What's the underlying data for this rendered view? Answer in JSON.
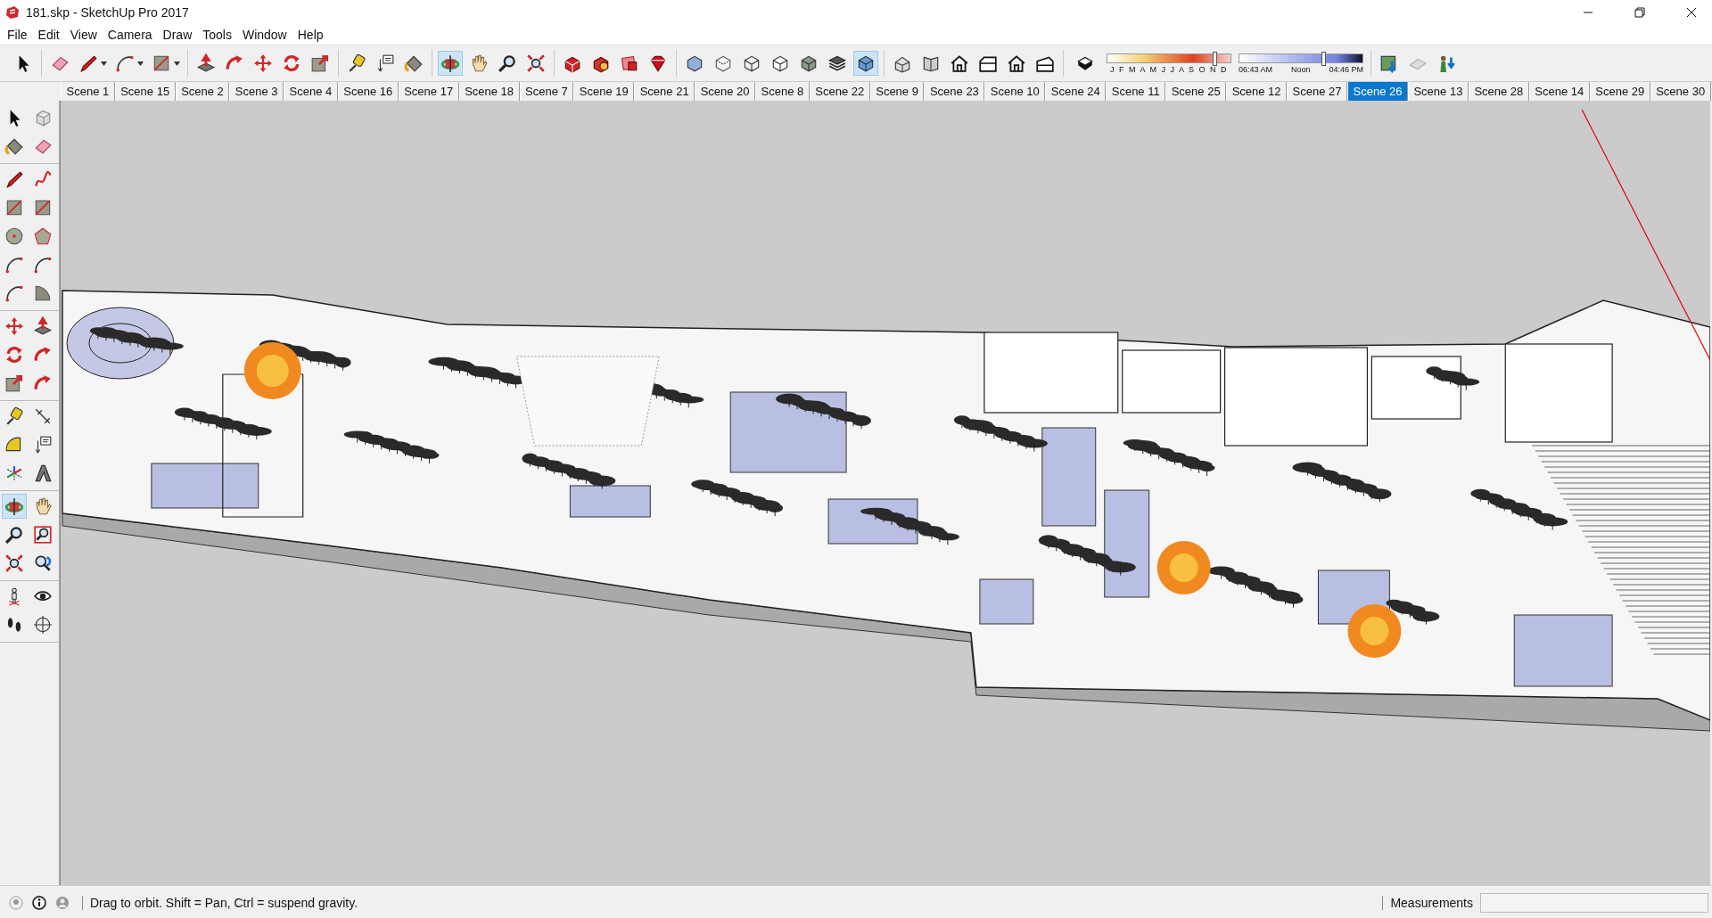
{
  "window": {
    "title": "181.skp - SketchUp Pro 2017"
  },
  "menu": [
    "File",
    "Edit",
    "View",
    "Camera",
    "Draw",
    "Tools",
    "Window",
    "Help"
  ],
  "toolbar": {
    "groups": [
      [
        {
          "kind": "select",
          "selected": false
        }
      ],
      [
        {
          "kind": "eraser",
          "selected": false
        },
        {
          "kind": "pencil",
          "selected": false,
          "dropdown": true
        },
        {
          "kind": "arc",
          "selected": false,
          "dropdown": true
        },
        {
          "kind": "rectangle",
          "selected": false,
          "dropdown": true
        }
      ],
      [
        {
          "kind": "pushpull",
          "selected": false
        },
        {
          "kind": "followme",
          "selected": false
        },
        {
          "kind": "move",
          "selected": false
        },
        {
          "kind": "rotate",
          "selected": false
        },
        {
          "kind": "scale",
          "selected": false
        }
      ],
      [
        {
          "kind": "tape",
          "selected": false
        },
        {
          "kind": "text",
          "selected": false
        },
        {
          "kind": "paint",
          "selected": false
        }
      ],
      [
        {
          "kind": "orbit",
          "selected": true
        },
        {
          "kind": "pan",
          "selected": false
        },
        {
          "kind": "zoom",
          "selected": false
        },
        {
          "kind": "zoomext",
          "selected": false
        }
      ],
      [
        {
          "kind": "warehouse",
          "selected": false
        },
        {
          "kind": "extension",
          "selected": false
        },
        {
          "kind": "share",
          "selected": false
        },
        {
          "kind": "ruby",
          "selected": false
        }
      ],
      [
        {
          "kind": "xray",
          "selected": false
        },
        {
          "kind": "backedges",
          "selected": false
        },
        {
          "kind": "wireframe",
          "selected": false
        },
        {
          "kind": "hiddenline",
          "selected": false
        },
        {
          "kind": "shaded",
          "selected": false
        },
        {
          "kind": "textured",
          "selected": false
        },
        {
          "kind": "monochrome",
          "selected": true
        }
      ],
      [
        {
          "kind": "iso",
          "selected": false
        },
        {
          "kind": "top",
          "selected": false
        },
        {
          "kind": "house",
          "selected": false
        },
        {
          "kind": "right",
          "selected": false
        },
        {
          "kind": "house",
          "selected": false
        },
        {
          "kind": "left",
          "selected": false
        }
      ]
    ]
  },
  "shadows": {
    "on": false,
    "months": "J F M A M J J A S O N D",
    "month_slider": {
      "level": 0.87
    },
    "time_start": "06:43 AM",
    "time_mid": "Noon",
    "time_end": "04:46 PM",
    "time_slider": {
      "level": 0.68
    }
  },
  "extra_tools": [
    {
      "kind": "map"
    },
    {
      "kind": "terrain"
    },
    {
      "kind": "geo"
    }
  ],
  "scenes": [
    {
      "label": "Scene 1",
      "selected": false
    },
    {
      "label": "Scene 15",
      "selected": false
    },
    {
      "label": "Scene 2",
      "selected": false
    },
    {
      "label": "Scene 3",
      "selected": false
    },
    {
      "label": "Scene 4",
      "selected": false
    },
    {
      "label": "Scene 16",
      "selected": false
    },
    {
      "label": "Scene 17",
      "selected": false
    },
    {
      "label": "Scene 18",
      "selected": false
    },
    {
      "label": "Scene 7",
      "selected": false
    },
    {
      "label": "Scene 19",
      "selected": false
    },
    {
      "label": "Scene 21",
      "selected": false
    },
    {
      "label": "Scene 20",
      "selected": false
    },
    {
      "label": "Scene 8",
      "selected": false
    },
    {
      "label": "Scene 22",
      "selected": false
    },
    {
      "label": "Scene 9",
      "selected": false
    },
    {
      "label": "Scene 23",
      "selected": false
    },
    {
      "label": "Scene 10",
      "selected": false
    },
    {
      "label": "Scene 24",
      "selected": false
    },
    {
      "label": "Scene 11",
      "selected": false
    },
    {
      "label": "Scene 25",
      "selected": false
    },
    {
      "label": "Scene 12",
      "selected": false
    },
    {
      "label": "Scene 27",
      "selected": false
    },
    {
      "label": "Scene 26",
      "selected": true
    },
    {
      "label": "Scene 13",
      "selected": false
    },
    {
      "label": "Scene 28",
      "selected": false
    },
    {
      "label": "Scene 14",
      "selected": false
    },
    {
      "label": "Scene 29",
      "selected": false
    },
    {
      "label": "Scene 30",
      "selected": false
    }
  ],
  "palette": {
    "groups": [
      [
        {
          "kind": "select",
          "selected": false
        },
        {
          "kind": "component",
          "selected": false
        },
        {
          "kind": "paint",
          "selected": false
        },
        {
          "kind": "eraser",
          "selected": false
        }
      ],
      [
        {
          "kind": "pencil",
          "selected": false
        },
        {
          "kind": "freehand",
          "selected": false
        },
        {
          "kind": "rectangle",
          "selected": false
        },
        {
          "kind": "rectangle",
          "selected": false
        },
        {
          "kind": "circle",
          "selected": false
        },
        {
          "kind": "polygon",
          "selected": false
        },
        {
          "kind": "arc",
          "selected": false
        },
        {
          "kind": "arc",
          "selected": false
        },
        {
          "kind": "arc",
          "selected": false
        },
        {
          "kind": "pie",
          "selected": false
        }
      ],
      [
        {
          "kind": "move",
          "selected": false
        },
        {
          "kind": "pushpull",
          "selected": false
        },
        {
          "kind": "rotate",
          "selected": false
        },
        {
          "kind": "followme",
          "selected": false
        },
        {
          "kind": "scale",
          "selected": false
        },
        {
          "kind": "followme",
          "selected": false
        }
      ],
      [
        {
          "kind": "tape",
          "selected": false
        },
        {
          "kind": "dimension",
          "selected": false
        },
        {
          "kind": "protractor",
          "selected": false
        },
        {
          "kind": "text",
          "selected": false
        },
        {
          "kind": "axes",
          "selected": false
        },
        {
          "kind": "text3d",
          "selected": false
        }
      ],
      [
        {
          "kind": "orbit",
          "selected": true
        },
        {
          "kind": "pan",
          "selected": false
        },
        {
          "kind": "zoom",
          "selected": false
        },
        {
          "kind": "zoomwindow",
          "selected": false
        },
        {
          "kind": "zoomext",
          "selected": false
        },
        {
          "kind": "previous",
          "selected": false
        }
      ],
      [
        {
          "kind": "position",
          "selected": false
        },
        {
          "kind": "eye",
          "selected": false
        },
        {
          "kind": "walk",
          "selected": false
        },
        {
          "kind": "section",
          "selected": false
        }
      ]
    ]
  },
  "status_bar": {
    "hint": "Drag to orbit. Shift = Pan, Ctrl = suspend gravity.",
    "measurements_label": "Measurements"
  }
}
